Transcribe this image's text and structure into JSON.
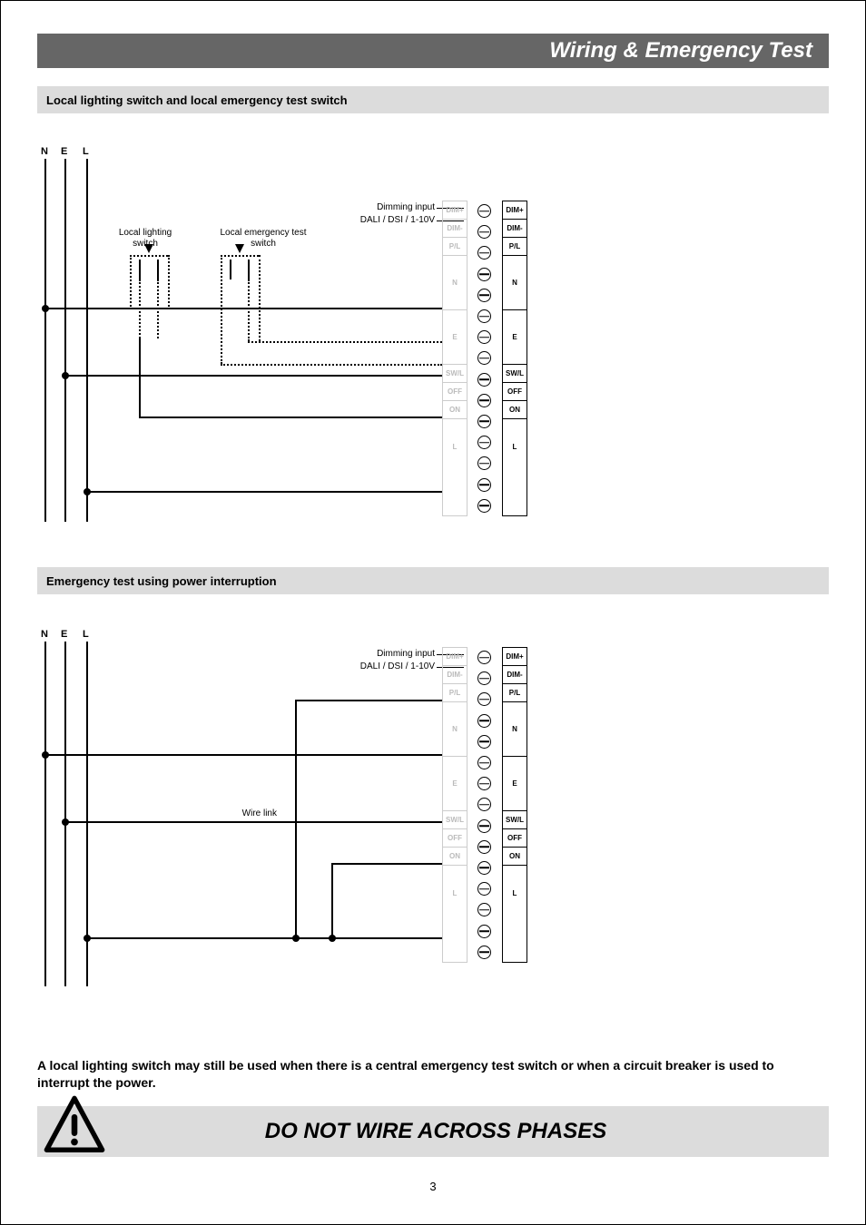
{
  "header": {
    "title": "Wiring & Emergency Test"
  },
  "sections": {
    "s1": "Local lighting switch and local emergency test switch",
    "s2": "Emergency test using power interruption"
  },
  "bus": {
    "n": "N",
    "e": "E",
    "l": "L"
  },
  "labels": {
    "dimming1": "Dimming input",
    "dimming2": "DALI / DSI / 1-10V",
    "local_lighting": "Local lighting\nswitch",
    "local_emerg": "Local emergency test\nswitch",
    "wire_link": "Wire link"
  },
  "terminals_faded": [
    "DIM+",
    "DIM-",
    "P/L",
    "",
    "N",
    "",
    "",
    "E",
    "",
    "SW/L",
    "OFF",
    "ON",
    "",
    "L",
    ""
  ],
  "terminals": {
    "dimp": "DIM+",
    "dimm": "DIM-",
    "pl": "P/L",
    "n": "N",
    "e": "E",
    "swl": "SW/L",
    "off": "OFF",
    "on": "ON",
    "l": "L"
  },
  "note": "A local lighting switch may still be used when there is a central emergency test switch or when a circuit breaker is  used to interrupt the power.",
  "warning": "DO NOT WIRE ACROSS PHASES",
  "page": "3"
}
